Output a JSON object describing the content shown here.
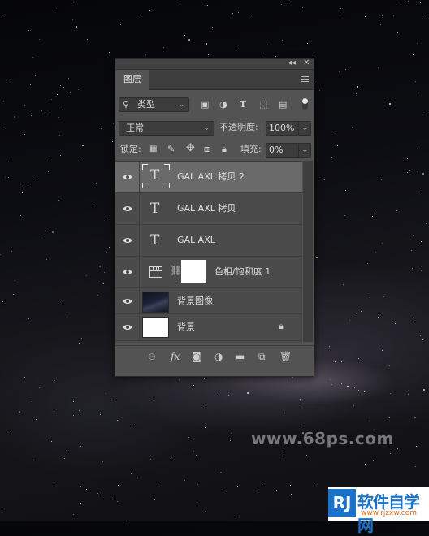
{
  "panel": {
    "tab_label": "图层",
    "collapse_label": "◂◂",
    "close_label": "✕",
    "filter": {
      "selected": "类型",
      "toggle_state": "on"
    },
    "blend_mode": "正常",
    "opacity": {
      "label": "不透明度:",
      "value": "100%"
    },
    "lock_label": "锁定:",
    "fill": {
      "label": "填充:",
      "value": "0%"
    },
    "layers": [
      {
        "name": "GAL AXL 拷贝 2",
        "type": "text",
        "visible": true,
        "selected": true
      },
      {
        "name": "GAL AXL 拷贝",
        "type": "text",
        "visible": true,
        "selected": false
      },
      {
        "name": "GAL AXL",
        "type": "text",
        "visible": true,
        "selected": false
      },
      {
        "name": "色相/饱和度 1",
        "type": "adjustment",
        "visible": true,
        "selected": false
      },
      {
        "name": "背景图像",
        "type": "image",
        "visible": true,
        "selected": false
      },
      {
        "name": "背景",
        "type": "background",
        "visible": true,
        "selected": false,
        "locked": true
      }
    ],
    "filter_icons": [
      "image-filter-icon",
      "adjustment-filter-icon",
      "type-filter-icon",
      "shape-filter-icon",
      "smart-object-filter-icon"
    ],
    "lock_icons": [
      "lock-transparent-icon",
      "lock-image-icon",
      "lock-position-icon",
      "lock-artboard-icon",
      "lock-all-icon"
    ],
    "bottom_icons": [
      "link-layers-icon",
      "fx-icon",
      "add-mask-icon",
      "new-adjustment-icon",
      "new-group-icon",
      "new-layer-icon",
      "delete-layer-icon"
    ],
    "fx_label": "fx"
  },
  "watermark": "www.68ps.com",
  "logo": {
    "mark": "RJ",
    "text": "软件自学网",
    "sub": "www.rjzxw.com"
  },
  "colors": {
    "panel": "#535353",
    "selected_row": "#6a6a6a",
    "logo_blue": "#1a73c9"
  }
}
